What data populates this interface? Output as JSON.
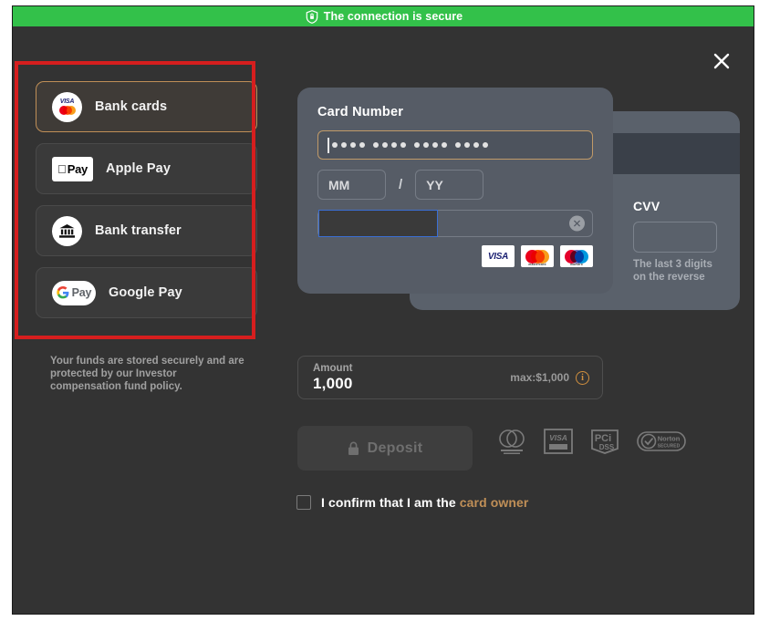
{
  "banner": {
    "icon": "shield-lock-icon",
    "text": "The connection is secure",
    "bg_color": "#33c14a"
  },
  "dialog": {
    "close_label": "×",
    "bg_color": "#333333"
  },
  "payment_methods": {
    "items": [
      {
        "id": "bank-cards",
        "label": "Bank cards",
        "icon": "visa-mastercard-circle-icon",
        "selected": true
      },
      {
        "id": "apple-pay",
        "label": "Apple Pay",
        "icon": "apple-pay-icon",
        "selected": false
      },
      {
        "id": "bank-transfer",
        "label": "Bank transfer",
        "icon": "bank-building-icon",
        "selected": false
      },
      {
        "id": "google-pay",
        "label": "Google Pay",
        "icon": "google-pay-icon",
        "selected": false
      }
    ],
    "selected_border_color": "#c08f57"
  },
  "funds_note": "Your funds are stored securely and are protected by our Investor compensation fund policy.",
  "annotation": {
    "type": "highlight-rectangle",
    "color": "#d61e1e"
  },
  "card_form": {
    "title": "Card Number",
    "number_mask": "•••• •••• •••• ••••",
    "number_focused": true,
    "expiry_month_placeholder": "MM",
    "separator": "/",
    "expiry_year_placeholder": "YY",
    "redacted_field": {
      "value": "",
      "redacted": true,
      "clear_icon": "clear-circle-icon"
    },
    "brands": [
      {
        "id": "visa",
        "label": "VISA",
        "sub": ""
      },
      {
        "id": "mastercard",
        "label": "",
        "sub": "mastercard"
      },
      {
        "id": "maestro",
        "label": "",
        "sub": "maestro"
      }
    ]
  },
  "cvv_panel": {
    "title": "CVV",
    "value": "",
    "hint_line1": "The last 3 digits",
    "hint_line2": "on the reverse"
  },
  "amount": {
    "label": "Amount",
    "value": "1,000",
    "max_text": "max:$1,000",
    "info_icon": "info-icon",
    "info_glyph": "i",
    "accent_color": "#d1903f"
  },
  "deposit": {
    "label": "Deposit",
    "icon": "lock-icon",
    "disabled": true
  },
  "security_badges": [
    {
      "id": "mastercard-securecode",
      "name": "mastercard-securecode-badge"
    },
    {
      "id": "visa-secure",
      "name": "visa-secure-badge",
      "label": "VISA"
    },
    {
      "id": "pci-dss",
      "name": "pci-dss-badge",
      "label": "PCI",
      "sub": "DSS"
    },
    {
      "id": "norton-secured",
      "name": "norton-secured-badge",
      "label": "Norton"
    }
  ],
  "confirm": {
    "checked": false,
    "text_plain": "I confirm that I am the ",
    "text_link": "card owner"
  }
}
